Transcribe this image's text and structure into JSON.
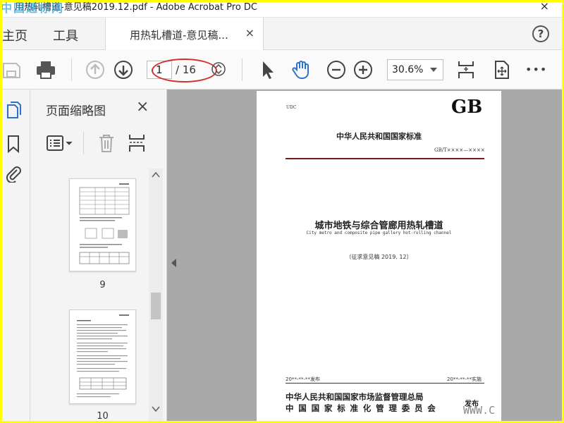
{
  "window": {
    "title": "用热轧槽道-意见稿2019.12.pdf - Adobe Acrobat Pro DC",
    "watermark_top": "中国通标网",
    "watermark_bottom": "WWW.C"
  },
  "tabs": {
    "home": "主页",
    "tools": "工具",
    "document": "用热轧槽道-意见稿...",
    "close": "×"
  },
  "toolbar": {
    "current_page": "1",
    "total_pages": "/ 16",
    "zoom": "30.6%",
    "more": "•••"
  },
  "thumbnails_panel": {
    "title": "页面缩略图",
    "close": "×",
    "pages": [
      {
        "number": "9"
      },
      {
        "number": "10"
      }
    ]
  },
  "document_page": {
    "udc": "UDC",
    "gb": "GB",
    "national_standard": "中华人民共和国国家标准",
    "code": "GB/T××××—××××",
    "title_cn": "城市地铁与综合管廊用热轧槽道",
    "title_en": "City metro and composite pipe gallery hot-rolling channel",
    "draft": "（征求意见稿 2019. 12）",
    "publish_date": "20**-**-**发布",
    "implement_date": "20**-**-**实施",
    "authority_1": "中华人民共和国国家市场监督管理总局",
    "authority_2": "中国国家标准化管理委员会",
    "issue": "发布"
  },
  "colors": {
    "frame_border": "#ffff00",
    "annotation_ellipse": "#d52b2b",
    "accent_blue": "#2b73c9",
    "document_rule": "#7a1a1a"
  }
}
